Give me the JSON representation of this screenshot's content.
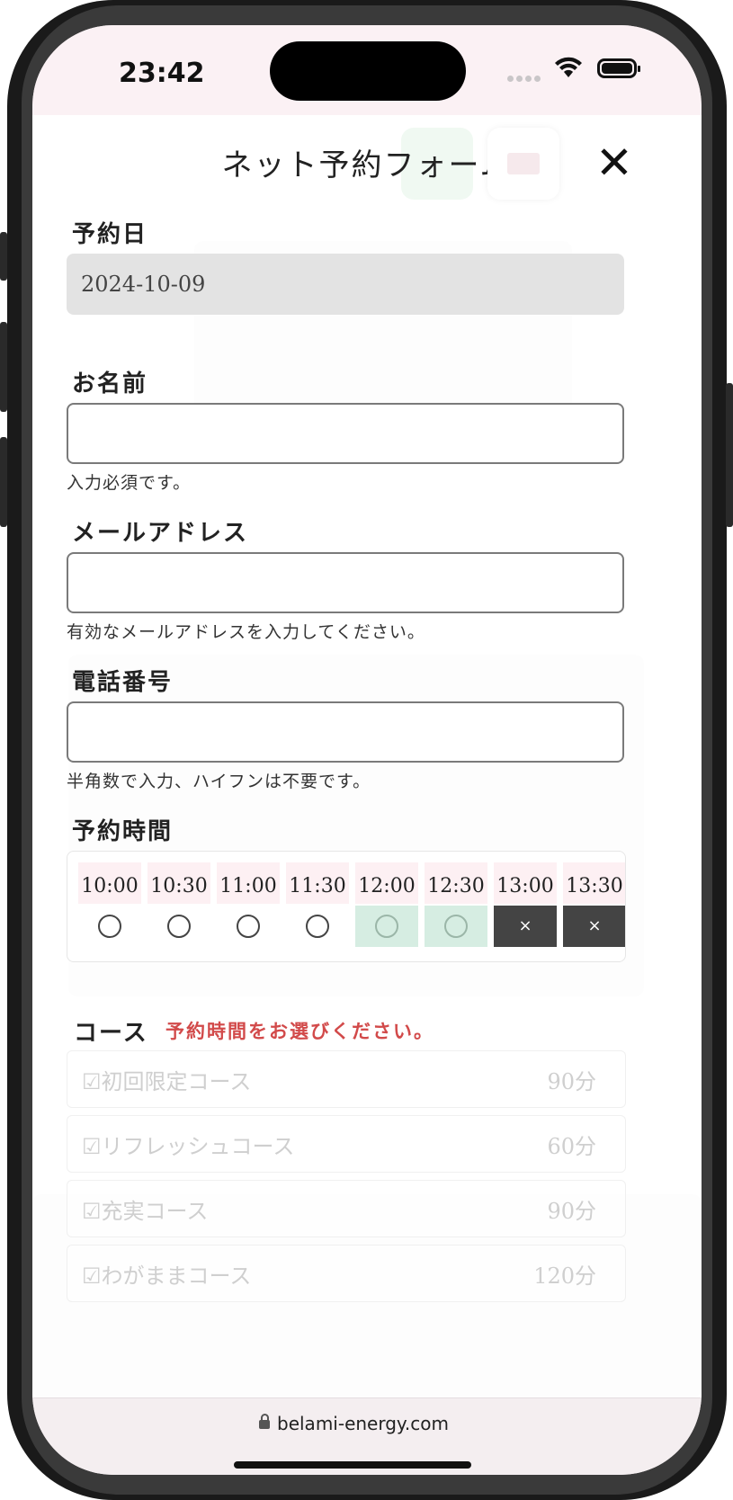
{
  "status_bar": {
    "time": "23:42"
  },
  "form": {
    "title": "ネット予約フォーム",
    "close_label": "✕",
    "date": {
      "label": "予約日",
      "value": "2024-10-09"
    },
    "name": {
      "label": "お名前",
      "value": "",
      "hint": "入力必須です。"
    },
    "email": {
      "label": "メールアドレス",
      "value": "",
      "hint": "有効なメールアドレスを入力してください。"
    },
    "phone": {
      "label": "電話番号",
      "value": "",
      "hint": "半角数で入力、ハイフンは不要です。"
    },
    "time": {
      "label": "予約時間",
      "slots": [
        {
          "time": "10:00",
          "status": "available"
        },
        {
          "time": "10:30",
          "status": "available"
        },
        {
          "time": "11:00",
          "status": "available"
        },
        {
          "time": "11:30",
          "status": "available"
        },
        {
          "time": "12:00",
          "status": "available-highlighted"
        },
        {
          "time": "12:30",
          "status": "available-highlighted"
        },
        {
          "time": "13:00",
          "status": "full",
          "mark": "×"
        },
        {
          "time": "13:30",
          "status": "full",
          "mark": "×"
        }
      ]
    },
    "course": {
      "label": "コース",
      "warning": "予約時間をお選びください。",
      "items": [
        {
          "name": "☑初回限定コース",
          "duration": "90分"
        },
        {
          "name": "☑リフレッシュコース",
          "duration": "60分"
        },
        {
          "name": "☑充実コース",
          "duration": "90分"
        },
        {
          "name": "☑わがままコース",
          "duration": "120分"
        }
      ]
    }
  },
  "browser": {
    "url": "belami-energy.com"
  },
  "colors": {
    "warning": "#d24a4a",
    "slot_highlight": "#d6ede2",
    "slot_full": "#444444",
    "slot_header": "#fdf0f3"
  }
}
